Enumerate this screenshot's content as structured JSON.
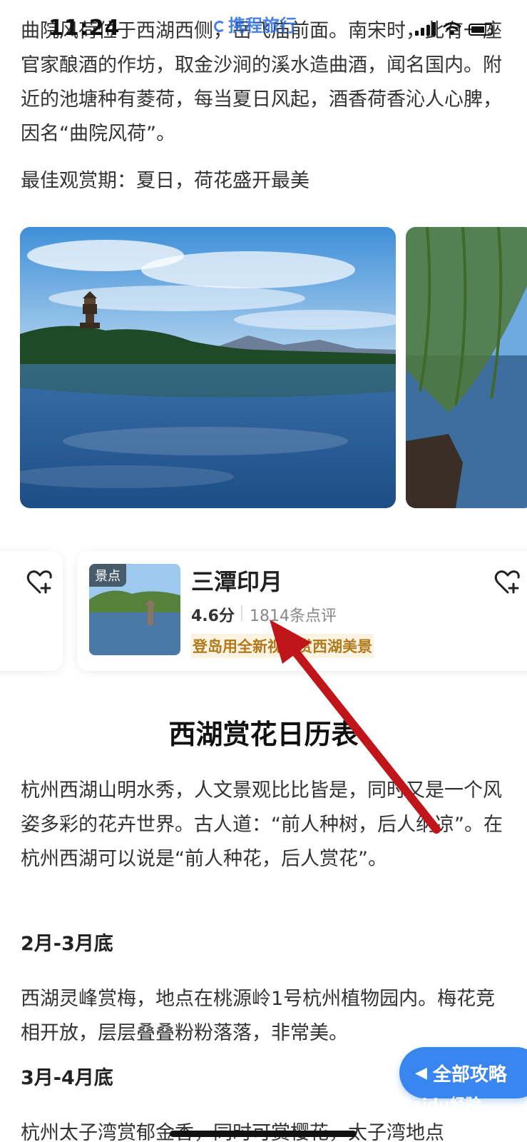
{
  "status_bar": {
    "time": "11:24",
    "brand": "携程旅行"
  },
  "article": {
    "para1": "曲院风荷位于西湖西侧，岳飞庙前面。南宋时，此有一座官家酿酒的作坊，取金沙涧的溪水造曲酒，闻名国内。附近的池塘种有菱荷，每当夏日风起，酒香荷香沁人心脾，因名“曲院风荷”。",
    "best_time": "最佳观赏期：夏日，荷花盛开最美"
  },
  "poi_card": {
    "tag": "景点",
    "name": "三潭印月",
    "score": "4.6分",
    "reviews": "1814条点评",
    "highlight": "登岛用全新视角赏西湖美景"
  },
  "section": {
    "title": "西湖赏花日历表",
    "intro": "杭州西湖山明水秀，人文景观比比皆是，同时又是一个风姿多彩的花卉世界。古人道：“前人种树，后人纳凉”。在杭州西湖可以说是“前人种花，后人赏花”。",
    "period1_title": "2月-3月底",
    "period1_text": "西湖灵峰赏梅，地点在桃源岭1号杭州植物园内。梅花竞相开放，层层叠叠粉粉落落，非常美。",
    "period2_title": "3月-4月底",
    "period2_text": "杭州太子湾赏郁金香，同时可赏樱花，太子湾地点"
  },
  "fab": {
    "label": "全部攻略"
  },
  "watermark": "Baidu经验",
  "colors": {
    "accent": "#3a86f0",
    "highlight_text": "#b07a1c",
    "arrow": "#c0161b"
  },
  "icons": [
    "heart-plus-icon",
    "chevron-left-icon",
    "signal-icon",
    "wifi-icon",
    "battery-icon"
  ]
}
